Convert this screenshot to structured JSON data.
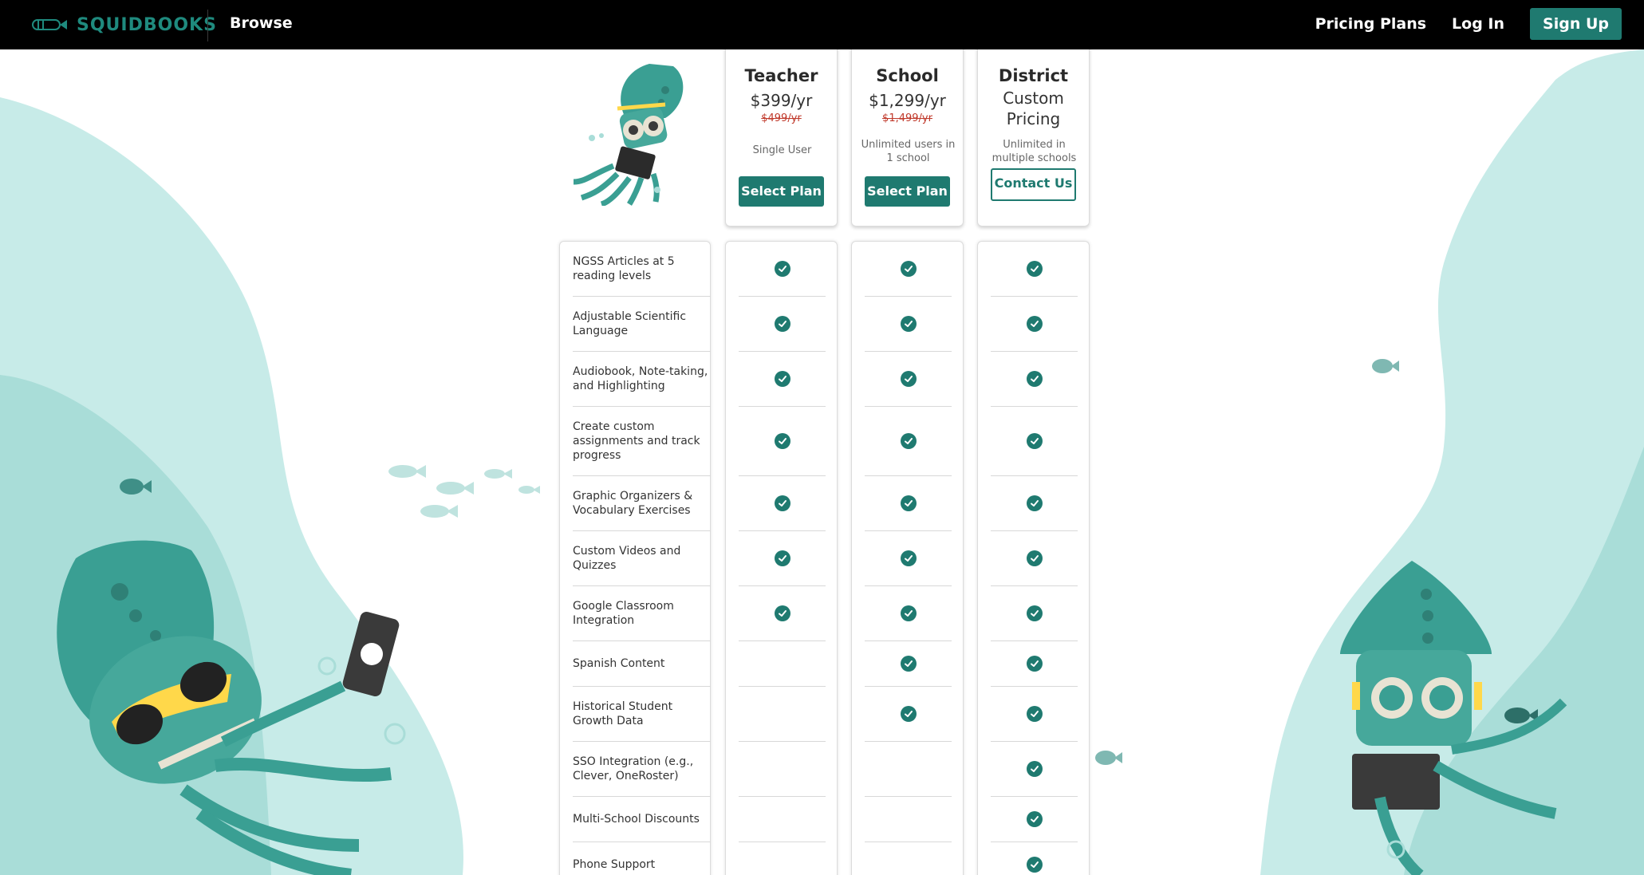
{
  "nav": {
    "logo_text": "SQUIDBOOKS",
    "browse": "Browse",
    "pricing": "Pricing Plans",
    "login": "Log In",
    "signup": "Sign Up"
  },
  "colors": {
    "brand": "#1f7a70",
    "brand_light": "#1f8a7e",
    "strike": "#c0392b",
    "sea": "#c4e8e5"
  },
  "plans": [
    {
      "name": "Teacher",
      "price": "$399/yr",
      "old_price": "$499/yr",
      "desc": "Single User",
      "button": "Select Plan"
    },
    {
      "name": "School",
      "price": "$1,299/yr",
      "old_price": "$1,499/yr",
      "desc": "Unlimited users in 1 school",
      "button": "Select Plan"
    },
    {
      "name": "District",
      "price": "Custom Pricing",
      "desc": "Unlimited in multiple schools",
      "button": "Contact Us"
    }
  ],
  "features": [
    {
      "label": "NGSS Articles at 5 reading levels",
      "teacher": true,
      "school": true,
      "district": true
    },
    {
      "label": "Adjustable Scientific Language",
      "teacher": true,
      "school": true,
      "district": true
    },
    {
      "label": "Audiobook, Note-taking, and Highlighting",
      "teacher": true,
      "school": true,
      "district": true
    },
    {
      "label": "Create custom assignments and track progress",
      "teacher": true,
      "school": true,
      "district": true
    },
    {
      "label": "Graphic Organizers & Vocabulary Exercises",
      "teacher": true,
      "school": true,
      "district": true
    },
    {
      "label": "Custom Videos and Quizzes",
      "teacher": true,
      "school": true,
      "district": true
    },
    {
      "label": "Google Classroom Integration",
      "teacher": true,
      "school": true,
      "district": true
    },
    {
      "label": "Spanish Content",
      "teacher": false,
      "school": true,
      "district": true
    },
    {
      "label": "Historical Student Growth Data",
      "teacher": false,
      "school": true,
      "district": true
    },
    {
      "label": "SSO Integration (e.g., Clever, OneRoster)",
      "teacher": false,
      "school": false,
      "district": true
    },
    {
      "label": "Multi-School Discounts",
      "teacher": false,
      "school": false,
      "district": true
    },
    {
      "label": "Phone Support",
      "teacher": false,
      "school": false,
      "district": true
    }
  ]
}
